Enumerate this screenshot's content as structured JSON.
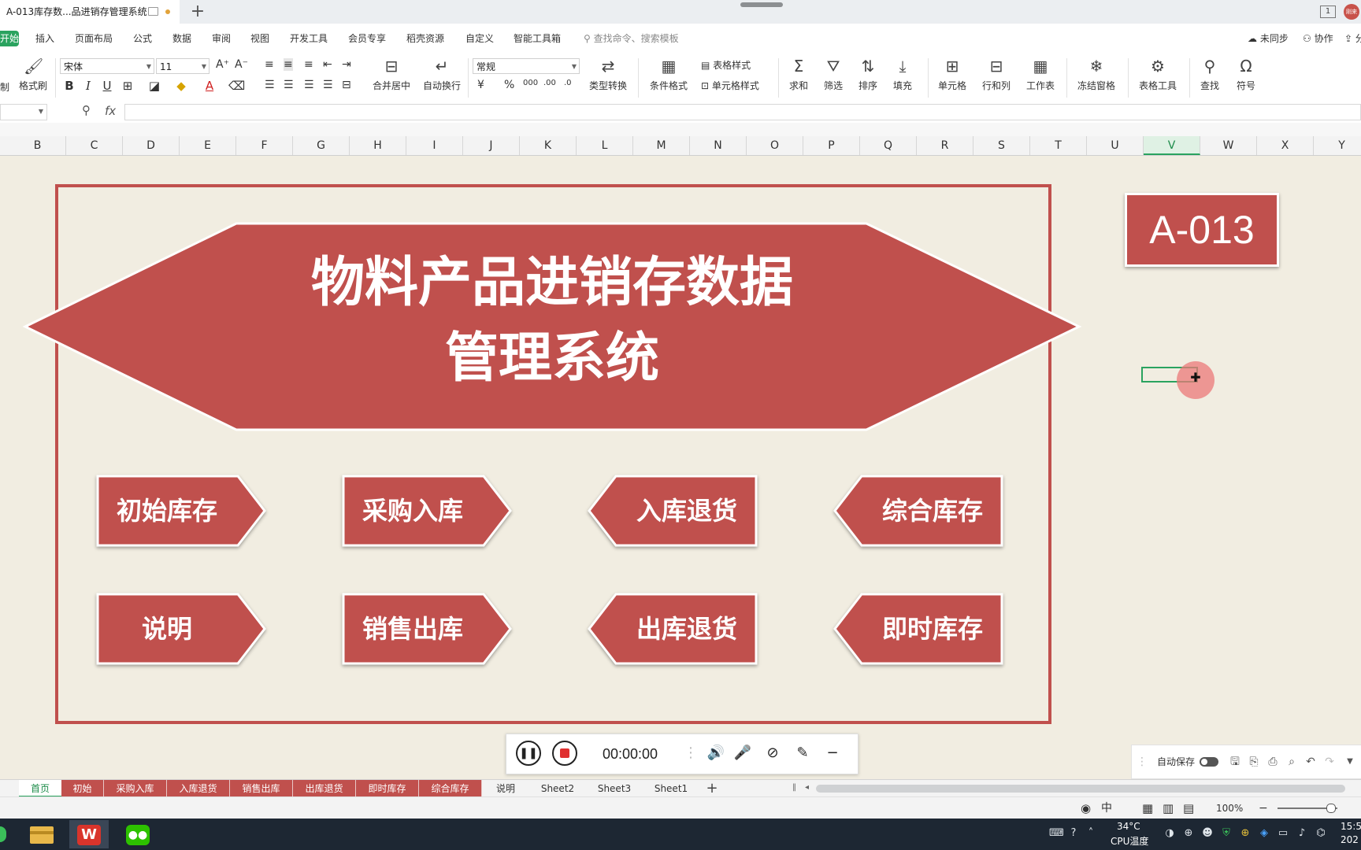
{
  "titlebar": {
    "doc_tab": "A-013库存数...品进销存管理系统",
    "window_count": "1",
    "avatar_text": "刚来"
  },
  "menu": {
    "start": "开始",
    "items": [
      "插入",
      "页面布局",
      "公式",
      "数据",
      "审阅",
      "视图",
      "开发工具",
      "会员专享",
      "稻壳资源",
      "自定义",
      "智能工具箱"
    ],
    "search_placeholder": "查找命令、搜索模板",
    "sync": "未同步",
    "collab": "协作",
    "share": "分"
  },
  "ribbon": {
    "format_painter": "格式刷",
    "paste_fragment": "制",
    "font_name": "宋体",
    "font_size": "11",
    "merge_center": "合并居中",
    "wrap_text": "自动换行",
    "number_format": "常规",
    "type_convert": "类型转换",
    "cond_format": "条件格式",
    "table_style": "表格样式",
    "cell_style": "单元格样式",
    "sum": "求和",
    "filter": "筛选",
    "sort": "排序",
    "fill": "填充",
    "cell": "单元格",
    "row_col": "行和列",
    "worksheet": "工作表",
    "freeze": "冻结窗格",
    "table_tools": "表格工具",
    "find": "查找",
    "symbol": "符号"
  },
  "formula_bar": {
    "fx": "fx",
    "value": ""
  },
  "columns": [
    "B",
    "C",
    "D",
    "E",
    "F",
    "G",
    "H",
    "I",
    "J",
    "K",
    "L",
    "M",
    "N",
    "O",
    "P",
    "Q",
    "R",
    "S",
    "T",
    "U",
    "V",
    "W",
    "X",
    "Y"
  ],
  "selected_column": "V",
  "sheet": {
    "title_line1": "物料产品进销存数据",
    "title_line2": "管理系统",
    "code": "A-013",
    "buttons": [
      {
        "label": "初始库存",
        "direction": "right"
      },
      {
        "label": "采购入库",
        "direction": "right"
      },
      {
        "label": "入库退货",
        "direction": "left"
      },
      {
        "label": "综合库存",
        "direction": "left"
      },
      {
        "label": "说明",
        "direction": "right"
      },
      {
        "label": "销售出库",
        "direction": "right"
      },
      {
        "label": "出库退货",
        "direction": "left"
      },
      {
        "label": "即时库存",
        "direction": "left"
      }
    ],
    "accent_color": "#c0504d"
  },
  "recorder": {
    "time": "00:00:00"
  },
  "autosave": {
    "label": "自动保存"
  },
  "tabs": [
    {
      "label": "首页",
      "style": "active"
    },
    {
      "label": "初始",
      "style": "red"
    },
    {
      "label": "采购入库",
      "style": "red"
    },
    {
      "label": "入库退货",
      "style": "red"
    },
    {
      "label": "销售出库",
      "style": "red"
    },
    {
      "label": "出库退货",
      "style": "red"
    },
    {
      "label": "即时库存",
      "style": "red"
    },
    {
      "label": "综合库存",
      "style": "red"
    },
    {
      "label": "说明",
      "style": "plain"
    },
    {
      "label": "Sheet2",
      "style": "plain"
    },
    {
      "label": "Sheet3",
      "style": "plain"
    },
    {
      "label": "Sheet1",
      "style": "plain"
    }
  ],
  "status": {
    "zoom": "100%"
  },
  "taskbar": {
    "temp": "34°C",
    "cpu_label": "CPU温度",
    "time": "15:5",
    "date": "202"
  }
}
